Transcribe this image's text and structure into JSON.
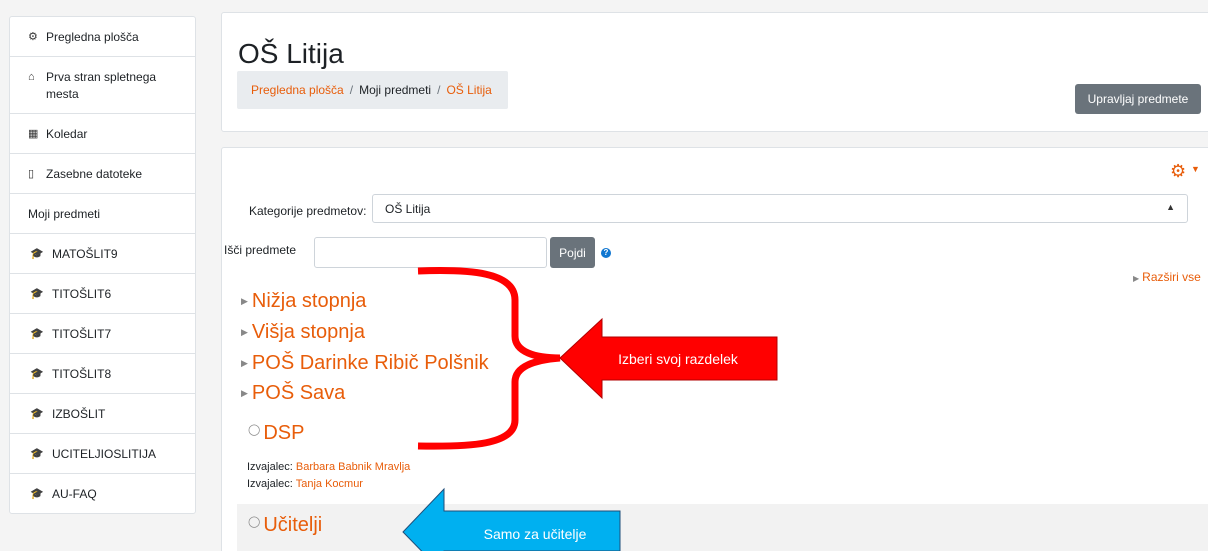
{
  "sidebar": {
    "items": [
      {
        "label": "Pregledna plošča",
        "icon": "dashboard-icon",
        "glyph": "⚙"
      },
      {
        "label": "Prva stran spletnega mesta",
        "icon": "home-icon",
        "glyph": "⌂"
      },
      {
        "label": "Koledar",
        "icon": "calendar-icon",
        "glyph": "▦"
      },
      {
        "label": "Zasebne datoteke",
        "icon": "file-icon",
        "glyph": "▯"
      },
      {
        "label": "Moji predmeti"
      },
      {
        "label": "MATOŠLIT9",
        "icon": "graduation-cap-icon"
      },
      {
        "label": "TITOŠLIT6",
        "icon": "graduation-cap-icon"
      },
      {
        "label": "TITOŠLIT7",
        "icon": "graduation-cap-icon"
      },
      {
        "label": "TITOŠLIT8",
        "icon": "graduation-cap-icon"
      },
      {
        "label": "IZBOŠLIT",
        "icon": "graduation-cap-icon"
      },
      {
        "label": "UCITELJIOSLITIJA",
        "icon": "graduation-cap-icon"
      },
      {
        "label": "AU-FAQ",
        "icon": "graduation-cap-icon"
      }
    ]
  },
  "header": {
    "title": "OŠ Litija",
    "breadcrumb": [
      "Pregledna plošča",
      "Moji predmeti",
      "OŠ Litija"
    ],
    "manage_button": "Upravljaj predmete"
  },
  "main": {
    "category_label": "Kategorije predmetov:",
    "category_value": "OŠ Litija",
    "search_label": "Išči predmete",
    "search_value": "",
    "go_button": "Pojdi",
    "expand_all": "Razširi vse",
    "categories": [
      "Nižja stopnja",
      "Višja stopnja",
      "POŠ Darinke Ribič Polšnik",
      "POŠ Sava"
    ],
    "courses": [
      {
        "name": "DSP",
        "teachers": [
          {
            "role": "Izvajalec:",
            "name": "Barbara Babnik Mravlja"
          },
          {
            "role": "Izvajalec:",
            "name": "Tanja Kocmur"
          }
        ]
      },
      {
        "name": "Učitelji"
      }
    ]
  },
  "annotations": {
    "red_arrow_text": "Izberi svoj razdelek",
    "blue_arrow_text": "Samo za učitelje"
  },
  "colors": {
    "accent": "#e85d0a",
    "annotation_red": "#ff0000",
    "annotation_blue": "#00b0f0"
  }
}
